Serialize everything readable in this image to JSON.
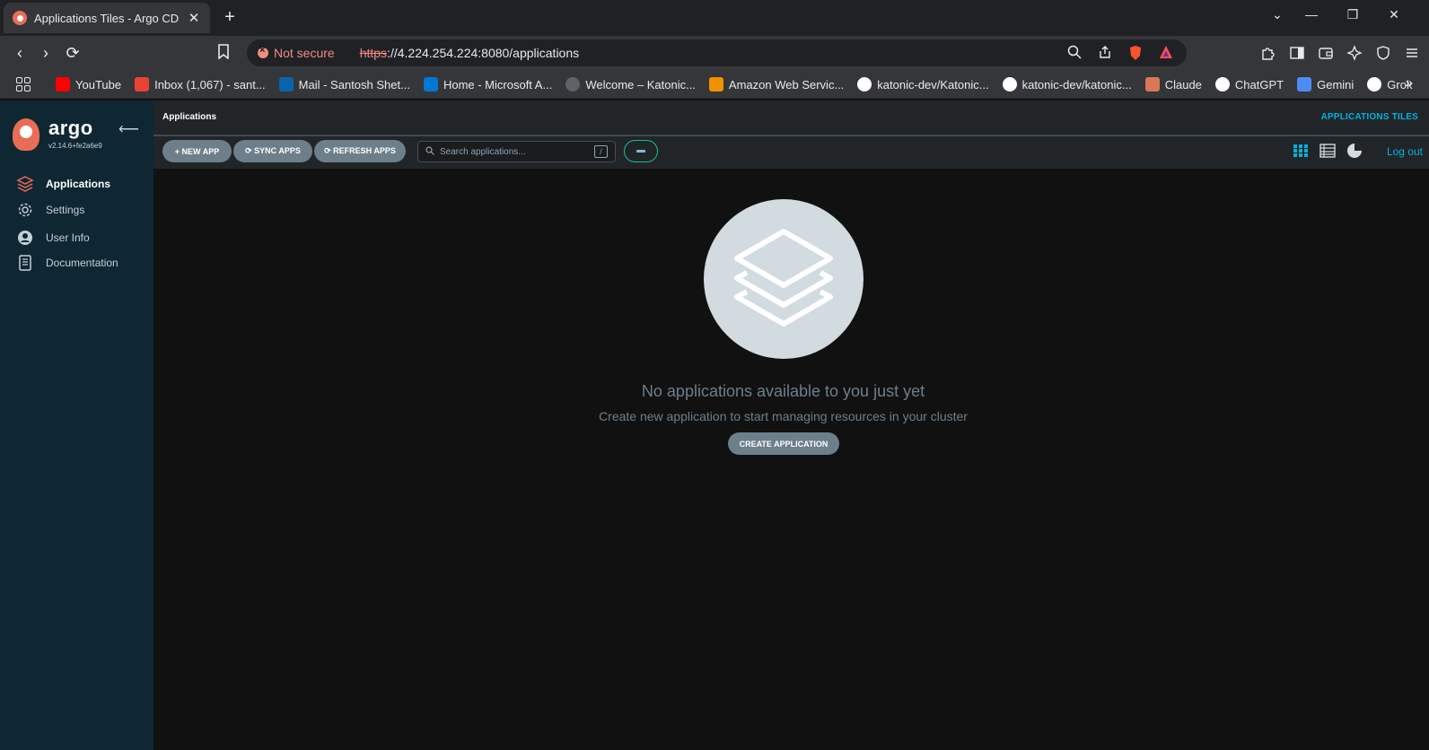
{
  "browser": {
    "tab_title": "Applications Tiles - Argo CD",
    "tab_close": "✕",
    "new_tab": "+",
    "security_label": "Not secure",
    "url_scheme": "https",
    "url_rest": "://4.224.254.224:8080/applications",
    "bookmarks": [
      {
        "label": "YouTube",
        "icon": "youtube-icon",
        "color": "#ff0000"
      },
      {
        "label": "Inbox (1,067) - sant...",
        "icon": "gmail-icon",
        "color": "#ea4335"
      },
      {
        "label": "Mail - Santosh Shet...",
        "icon": "outlook-icon",
        "color": "#0a64ad"
      },
      {
        "label": "Home - Microsoft A...",
        "icon": "azure-icon",
        "color": "#0078d4"
      },
      {
        "label": "Welcome – Katonic...",
        "icon": "katonic-icon",
        "color": "#5f6368"
      },
      {
        "label": "Amazon Web Servic...",
        "icon": "aws-icon",
        "color": "#f29100"
      },
      {
        "label": "katonic-dev/Katonic...",
        "icon": "github-icon",
        "color": "#ffffff"
      },
      {
        "label": "katonic-dev/katonic...",
        "icon": "github-icon",
        "color": "#ffffff"
      },
      {
        "label": "Claude",
        "icon": "claude-icon",
        "color": "#d97757"
      },
      {
        "label": "ChatGPT",
        "icon": "chatgpt-icon",
        "color": "#ffffff"
      },
      {
        "label": "Gemini",
        "icon": "gemini-icon",
        "color": "#4f8bf6"
      },
      {
        "label": "Grok",
        "icon": "grok-icon",
        "color": "#ffffff"
      }
    ]
  },
  "sidebar": {
    "logo_text": "argo",
    "version": "v2.14.6+fe2a6e9",
    "items": [
      {
        "label": "Applications",
        "icon": "layers-icon",
        "active": true
      },
      {
        "label": "Settings",
        "icon": "gear-icon",
        "active": false
      },
      {
        "label": "User Info",
        "icon": "user-icon",
        "active": false
      },
      {
        "label": "Documentation",
        "icon": "book-icon",
        "active": false
      }
    ]
  },
  "header": {
    "breadcrumb": "Applications",
    "page_mode": "APPLICATIONS TILES"
  },
  "toolbar": {
    "new_app": "+ NEW APP",
    "sync_apps": "⟳ SYNC APPS",
    "refresh_apps": "⟳ REFRESH APPS",
    "search_placeholder": "Search applications...",
    "search_shortcut": "/",
    "logout": "Log out"
  },
  "empty_state": {
    "title": "No applications available to you just yet",
    "subtitle": "Create new application to start managing resources in your cluster",
    "cta": "CREATE APPLICATION"
  },
  "colors": {
    "accent": "#00b2de",
    "brand": "#e96d56",
    "sidebar_bg": "#0f2733",
    "button_bg": "#6d7f8b"
  }
}
